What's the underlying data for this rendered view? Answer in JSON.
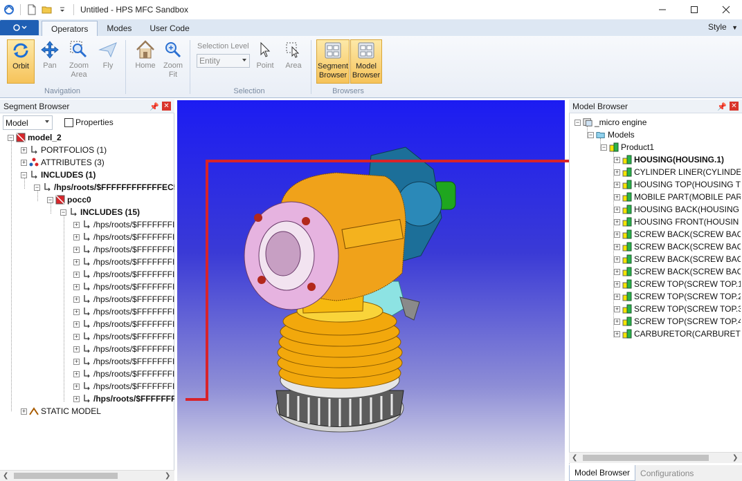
{
  "window": {
    "title": "Untitled - HPS MFC Sandbox"
  },
  "ribbon": {
    "tabs": [
      {
        "label": "Operators"
      },
      {
        "label": "Modes"
      },
      {
        "label": "User Code"
      }
    ],
    "style_label": "Style",
    "navigation": {
      "label": "Navigation",
      "buttons": [
        {
          "label": "Orbit",
          "icon": "orbit-icon"
        },
        {
          "label": "Pan",
          "icon": "pan-icon"
        },
        {
          "label": "Zoom Area",
          "icon": "zoom-area-icon"
        },
        {
          "label": "Fly",
          "icon": "fly-icon"
        }
      ]
    },
    "home_zoom": {
      "buttons": [
        {
          "label": "Home",
          "icon": "home-icon"
        },
        {
          "label": "Zoom Fit",
          "icon": "zoom-fit-icon"
        }
      ]
    },
    "selection": {
      "label": "Selection",
      "level_label": "Selection Level",
      "level_value": "Entity",
      "buttons": [
        {
          "label": "Point",
          "icon": "pointer-icon"
        },
        {
          "label": "Area",
          "icon": "area-select-icon"
        }
      ]
    },
    "browsers": {
      "label": "Browsers",
      "buttons": [
        {
          "label": "Segment Browser",
          "icon": "segment-browser-icon"
        },
        {
          "label": "Model Browser",
          "icon": "model-browser-icon"
        }
      ]
    }
  },
  "segment_browser": {
    "title": "Segment Browser",
    "model_select": "Model",
    "properties_label": "Properties",
    "tree": [
      {
        "label": "model_2",
        "bold": true,
        "level": 0
      },
      {
        "label": "PORTFOLIOS (1)",
        "level": 1
      },
      {
        "label": "ATTRIBUTES (3)",
        "level": 1
      },
      {
        "label": "INCLUDES (1)",
        "bold": true,
        "level": 1
      },
      {
        "label": "/hps/roots/$FFFFFFFFFFFFEC5",
        "bold": true,
        "level": 2
      },
      {
        "label": "pocc0",
        "bold": true,
        "level": 3
      },
      {
        "label": "INCLUDES (15)",
        "bold": true,
        "level": 4
      },
      {
        "label": "/hps/roots/$FFFFFFFI",
        "level": 5
      },
      {
        "label": "/hps/roots/$FFFFFFFI",
        "level": 5
      },
      {
        "label": "/hps/roots/$FFFFFFFI",
        "level": 5
      },
      {
        "label": "/hps/roots/$FFFFFFFI",
        "level": 5
      },
      {
        "label": "/hps/roots/$FFFFFFFI",
        "level": 5
      },
      {
        "label": "/hps/roots/$FFFFFFFI",
        "level": 5
      },
      {
        "label": "/hps/roots/$FFFFFFFI",
        "level": 5
      },
      {
        "label": "/hps/roots/$FFFFFFFI",
        "level": 5
      },
      {
        "label": "/hps/roots/$FFFFFFFI",
        "level": 5
      },
      {
        "label": "/hps/roots/$FFFFFFFI",
        "level": 5
      },
      {
        "label": "/hps/roots/$FFFFFFFI",
        "level": 5
      },
      {
        "label": "/hps/roots/$FFFFFFFI",
        "level": 5
      },
      {
        "label": "/hps/roots/$FFFFFFFI",
        "level": 5
      },
      {
        "label": "/hps/roots/$FFFFFFFI",
        "level": 5
      },
      {
        "label": "/hps/roots/$FFFFFFF",
        "bold": true,
        "level": 5
      },
      {
        "label": "STATIC MODEL",
        "level": 1
      }
    ]
  },
  "model_browser": {
    "title": "Model Browser",
    "root": "_micro engine",
    "models": "Models",
    "product": "Product1",
    "items": [
      {
        "label": "HOUSING(HOUSING.1)",
        "bold": true
      },
      {
        "label": "CYLINDER LINER(CYLINDER"
      },
      {
        "label": "HOUSING TOP(HOUSING T"
      },
      {
        "label": "MOBILE PART(MOBILE PAR"
      },
      {
        "label": "HOUSING BACK(HOUSING"
      },
      {
        "label": "HOUSING FRONT(HOUSIN"
      },
      {
        "label": "SCREW BACK(SCREW BACK"
      },
      {
        "label": "SCREW BACK(SCREW BACK"
      },
      {
        "label": "SCREW BACK(SCREW BACK"
      },
      {
        "label": "SCREW BACK(SCREW BACK"
      },
      {
        "label": "SCREW TOP(SCREW TOP.1)"
      },
      {
        "label": "SCREW TOP(SCREW TOP.2)"
      },
      {
        "label": "SCREW TOP(SCREW TOP.3)"
      },
      {
        "label": "SCREW TOP(SCREW TOP.4)"
      },
      {
        "label": "CARBURETOR(CARBURETO"
      }
    ],
    "tabs": [
      {
        "label": "Model Browser"
      },
      {
        "label": "Configurations"
      }
    ]
  },
  "colors": {
    "accent": "#1f5fb4",
    "highlight_line": "#d8232a",
    "active_button": "#f6c35a"
  }
}
